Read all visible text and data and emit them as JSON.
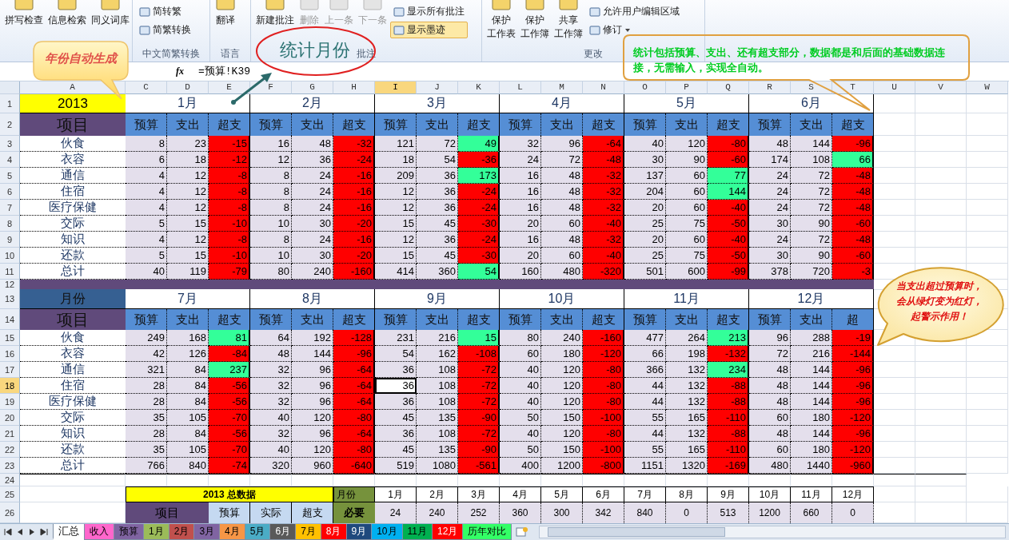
{
  "ribbon": {
    "groups": [
      {
        "large": [
          {
            "lines": [
              "拼写检查"
            ],
            "disabled": false
          },
          {
            "lines": [
              "信息检索"
            ],
            "disabled": false
          },
          {
            "lines": [
              "同义词库"
            ],
            "disabled": false
          }
        ]
      },
      {
        "label": "中文简繁转换",
        "small": [
          {
            "label": "简转繁",
            "selected": false,
            "dropdown": false
          },
          {
            "label": "简繁转换",
            "selected": false,
            "dropdown": false
          }
        ]
      },
      {
        "label": "语言",
        "large": [
          {
            "lines": [
              "翻译"
            ],
            "disabled": false
          }
        ]
      },
      {
        "label": "批注",
        "large": [
          {
            "lines": [
              "新建批注"
            ],
            "disabled": false
          },
          {
            "lines": [
              "删除"
            ],
            "disabled": true
          },
          {
            "lines": [
              "上一条"
            ],
            "disabled": true
          },
          {
            "lines": [
              "下一条"
            ],
            "disabled": true
          }
        ],
        "small": [
          {
            "label": "显示所有批注",
            "selected": false,
            "dropdown": false
          },
          {
            "label": "显示墨迹",
            "selected": true,
            "dropdown": false
          }
        ]
      },
      {
        "label": "更改",
        "large": [
          {
            "lines": [
              "保护",
              "工作表"
            ],
            "disabled": false
          },
          {
            "lines": [
              "保护",
              "工作簿"
            ],
            "disabled": false
          },
          {
            "lines": [
              "共享",
              "工作簿"
            ],
            "disabled": false
          }
        ],
        "small": [
          {
            "label": "允许用户编辑区域",
            "selected": false,
            "dropdown": false
          },
          {
            "label": "修订",
            "selected": false,
            "dropdown": true
          }
        ]
      }
    ]
  },
  "formula_bar": {
    "function_label": "fx",
    "formula": "=预算!K39"
  },
  "sheet": {
    "column_headers": [
      {
        "label": "A",
        "selected": false
      },
      {
        "label": "C",
        "selected": false
      },
      {
        "label": "D",
        "selected": false
      },
      {
        "label": "E",
        "selected": false
      },
      {
        "label": "F",
        "selected": false
      },
      {
        "label": "G",
        "selected": false
      },
      {
        "label": "H",
        "selected": false
      },
      {
        "label": "I",
        "selected": true
      },
      {
        "label": "J",
        "selected": false
      },
      {
        "label": "K",
        "selected": false
      },
      {
        "label": "L",
        "selected": false
      },
      {
        "label": "M",
        "selected": false
      },
      {
        "label": "N",
        "selected": false
      },
      {
        "label": "O",
        "selected": false
      },
      {
        "label": "P",
        "selected": false
      },
      {
        "label": "Q",
        "selected": false
      },
      {
        "label": "R",
        "selected": false
      },
      {
        "label": "S",
        "selected": false
      },
      {
        "label": "T",
        "selected": false
      },
      {
        "label": "U",
        "selected": false
      },
      {
        "label": "V",
        "selected": false
      },
      {
        "label": "W",
        "selected": false
      }
    ],
    "row_headers": [
      {
        "label": "1",
        "selected": false
      },
      {
        "label": "2",
        "selected": false
      },
      {
        "label": "3",
        "selected": false
      },
      {
        "label": "4",
        "selected": false
      },
      {
        "label": "5",
        "selected": false
      },
      {
        "label": "6",
        "selected": false
      },
      {
        "label": "7",
        "selected": false
      },
      {
        "label": "8",
        "selected": false
      },
      {
        "label": "9",
        "selected": false
      },
      {
        "label": "10",
        "selected": false
      },
      {
        "label": "11",
        "selected": false
      },
      {
        "label": "12",
        "selected": false
      },
      {
        "label": "13",
        "selected": false
      },
      {
        "label": "14",
        "selected": false
      },
      {
        "label": "15",
        "selected": false
      },
      {
        "label": "16",
        "selected": false
      },
      {
        "label": "17",
        "selected": false
      },
      {
        "label": "18",
        "selected": true
      },
      {
        "label": "19",
        "selected": false
      },
      {
        "label": "20",
        "selected": false
      },
      {
        "label": "21",
        "selected": false
      },
      {
        "label": "22",
        "selected": false
      },
      {
        "label": "23",
        "selected": false
      },
      {
        "label": "24",
        "selected": false
      },
      {
        "label": "25",
        "selected": false
      },
      {
        "label": "26",
        "selected": false
      }
    ],
    "blocks": [
      {
        "corner": "2013",
        "kind": "year",
        "item_header": "项目",
        "months": [
          {
            "label": "1月",
            "columns": [
              "预算",
              "支出",
              "超支"
            ]
          },
          {
            "label": "2月",
            "columns": [
              "预算",
              "支出",
              "超支"
            ]
          },
          {
            "label": "3月",
            "columns": [
              "预算",
              "支出",
              "超支"
            ]
          },
          {
            "label": "4月",
            "columns": [
              "预算",
              "支出",
              "超支"
            ]
          },
          {
            "label": "5月",
            "columns": [
              "预算",
              "支出",
              "超支"
            ]
          },
          {
            "label": "6月",
            "columns": [
              "预算",
              "支出",
              "超支"
            ]
          }
        ],
        "rows": [
          {
            "item": "伙食",
            "months": [
              {
                "values": [
                  "8",
                  "23",
                  "-15"
                ],
                "alert": true
              },
              {
                "values": [
                  "16",
                  "48",
                  "-32"
                ],
                "alert": true
              },
              {
                "values": [
                  "121",
                  "72",
                  "49"
                ],
                "alert": false
              },
              {
                "values": [
                  "32",
                  "96",
                  "-64"
                ],
                "alert": true
              },
              {
                "values": [
                  "40",
                  "120",
                  "-80"
                ],
                "alert": true
              },
              {
                "values": [
                  "48",
                  "144",
                  "-96"
                ],
                "alert": true
              }
            ]
          },
          {
            "item": "衣容",
            "months": [
              {
                "values": [
                  "6",
                  "18",
                  "-12"
                ],
                "alert": true
              },
              {
                "values": [
                  "12",
                  "36",
                  "-24"
                ],
                "alert": true
              },
              {
                "values": [
                  "18",
                  "54",
                  "-36"
                ],
                "alert": true
              },
              {
                "values": [
                  "24",
                  "72",
                  "-48"
                ],
                "alert": true
              },
              {
                "values": [
                  "30",
                  "90",
                  "-60"
                ],
                "alert": true
              },
              {
                "values": [
                  "174",
                  "108",
                  "66"
                ],
                "alert": false
              }
            ]
          },
          {
            "item": "通信",
            "months": [
              {
                "values": [
                  "4",
                  "12",
                  "-8"
                ],
                "alert": true
              },
              {
                "values": [
                  "8",
                  "24",
                  "-16"
                ],
                "alert": true
              },
              {
                "values": [
                  "209",
                  "36",
                  "173"
                ],
                "alert": false
              },
              {
                "values": [
                  "16",
                  "48",
                  "-32"
                ],
                "alert": true
              },
              {
                "values": [
                  "137",
                  "60",
                  "77"
                ],
                "alert": false
              },
              {
                "values": [
                  "24",
                  "72",
                  "-48"
                ],
                "alert": true
              }
            ]
          },
          {
            "item": "住宿",
            "months": [
              {
                "values": [
                  "4",
                  "12",
                  "-8"
                ],
                "alert": true
              },
              {
                "values": [
                  "8",
                  "24",
                  "-16"
                ],
                "alert": true
              },
              {
                "values": [
                  "12",
                  "36",
                  "-24"
                ],
                "alert": true
              },
              {
                "values": [
                  "16",
                  "48",
                  "-32"
                ],
                "alert": true
              },
              {
                "values": [
                  "204",
                  "60",
                  "144"
                ],
                "alert": false
              },
              {
                "values": [
                  "24",
                  "72",
                  "-48"
                ],
                "alert": true
              }
            ]
          },
          {
            "item": "医疗保健",
            "months": [
              {
                "values": [
                  "4",
                  "12",
                  "-8"
                ],
                "alert": true
              },
              {
                "values": [
                  "8",
                  "24",
                  "-16"
                ],
                "alert": true
              },
              {
                "values": [
                  "12",
                  "36",
                  "-24"
                ],
                "alert": true
              },
              {
                "values": [
                  "16",
                  "48",
                  "-32"
                ],
                "alert": true
              },
              {
                "values": [
                  "20",
                  "60",
                  "-40"
                ],
                "alert": true
              },
              {
                "values": [
                  "24",
                  "72",
                  "-48"
                ],
                "alert": true
              }
            ]
          },
          {
            "item": "交际",
            "months": [
              {
                "values": [
                  "5",
                  "15",
                  "-10"
                ],
                "alert": true
              },
              {
                "values": [
                  "10",
                  "30",
                  "-20"
                ],
                "alert": true
              },
              {
                "values": [
                  "15",
                  "45",
                  "-30"
                ],
                "alert": true
              },
              {
                "values": [
                  "20",
                  "60",
                  "-40"
                ],
                "alert": true
              },
              {
                "values": [
                  "25",
                  "75",
                  "-50"
                ],
                "alert": true
              },
              {
                "values": [
                  "30",
                  "90",
                  "-60"
                ],
                "alert": true
              }
            ]
          },
          {
            "item": "知识",
            "months": [
              {
                "values": [
                  "4",
                  "12",
                  "-8"
                ],
                "alert": true
              },
              {
                "values": [
                  "8",
                  "24",
                  "-16"
                ],
                "alert": true
              },
              {
                "values": [
                  "12",
                  "36",
                  "-24"
                ],
                "alert": true
              },
              {
                "values": [
                  "16",
                  "48",
                  "-32"
                ],
                "alert": true
              },
              {
                "values": [
                  "20",
                  "60",
                  "-40"
                ],
                "alert": true
              },
              {
                "values": [
                  "24",
                  "72",
                  "-48"
                ],
                "alert": true
              }
            ]
          },
          {
            "item": "还款",
            "months": [
              {
                "values": [
                  "5",
                  "15",
                  "-10"
                ],
                "alert": true
              },
              {
                "values": [
                  "10",
                  "30",
                  "-20"
                ],
                "alert": true
              },
              {
                "values": [
                  "15",
                  "45",
                  "-30"
                ],
                "alert": true
              },
              {
                "values": [
                  "20",
                  "60",
                  "-40"
                ],
                "alert": true
              },
              {
                "values": [
                  "25",
                  "75",
                  "-50"
                ],
                "alert": true
              },
              {
                "values": [
                  "30",
                  "90",
                  "-60"
                ],
                "alert": true
              }
            ]
          },
          {
            "item": "总计",
            "months": [
              {
                "values": [
                  "40",
                  "119",
                  "-79"
                ],
                "alert": true
              },
              {
                "values": [
                  "80",
                  "240",
                  "-160"
                ],
                "alert": true
              },
              {
                "values": [
                  "414",
                  "360",
                  "54"
                ],
                "alert": false
              },
              {
                "values": [
                  "160",
                  "480",
                  "-320"
                ],
                "alert": true
              },
              {
                "values": [
                  "501",
                  "600",
                  "-99"
                ],
                "alert": true
              },
              {
                "values": [
                  "378",
                  "720",
                  "-3"
                ],
                "alert": true
              }
            ]
          }
        ]
      },
      {
        "corner": "月份",
        "kind": "label",
        "item_header": "项目",
        "months": [
          {
            "label": "7月",
            "columns": [
              "预算",
              "支出",
              "超支"
            ]
          },
          {
            "label": "8月",
            "columns": [
              "预算",
              "支出",
              "超支"
            ]
          },
          {
            "label": "9月",
            "columns": [
              "预算",
              "支出",
              "超支"
            ]
          },
          {
            "label": "10月",
            "columns": [
              "预算",
              "支出",
              "超支"
            ]
          },
          {
            "label": "11月",
            "columns": [
              "预算",
              "支出",
              "超支"
            ]
          },
          {
            "label": "12月",
            "columns": [
              "预算",
              "支出",
              "超"
            ]
          }
        ],
        "rows": [
          {
            "item": "伙食",
            "months": [
              {
                "values": [
                  "249",
                  "168",
                  "81"
                ],
                "alert": false
              },
              {
                "values": [
                  "64",
                  "192",
                  "-128"
                ],
                "alert": true
              },
              {
                "values": [
                  "231",
                  "216",
                  "15"
                ],
                "alert": false
              },
              {
                "values": [
                  "80",
                  "240",
                  "-160"
                ],
                "alert": true
              },
              {
                "values": [
                  "477",
                  "264",
                  "213"
                ],
                "alert": false
              },
              {
                "values": [
                  "96",
                  "288",
                  "-19"
                ],
                "alert": true
              }
            ]
          },
          {
            "item": "衣容",
            "months": [
              {
                "values": [
                  "42",
                  "126",
                  "-84"
                ],
                "alert": true
              },
              {
                "values": [
                  "48",
                  "144",
                  "-96"
                ],
                "alert": true
              },
              {
                "values": [
                  "54",
                  "162",
                  "-108"
                ],
                "alert": true
              },
              {
                "values": [
                  "60",
                  "180",
                  "-120"
                ],
                "alert": true
              },
              {
                "values": [
                  "66",
                  "198",
                  "-132"
                ],
                "alert": true
              },
              {
                "values": [
                  "72",
                  "216",
                  "-144"
                ],
                "alert": true
              }
            ]
          },
          {
            "item": "通信",
            "months": [
              {
                "values": [
                  "321",
                  "84",
                  "237"
                ],
                "alert": false
              },
              {
                "values": [
                  "32",
                  "96",
                  "-64"
                ],
                "alert": true
              },
              {
                "values": [
                  "36",
                  "108",
                  "-72"
                ],
                "alert": true
              },
              {
                "values": [
                  "40",
                  "120",
                  "-80"
                ],
                "alert": true
              },
              {
                "values": [
                  "366",
                  "132",
                  "234"
                ],
                "alert": false
              },
              {
                "values": [
                  "48",
                  "144",
                  "-96"
                ],
                "alert": true
              }
            ]
          },
          {
            "item": "住宿",
            "months": [
              {
                "values": [
                  "28",
                  "84",
                  "-56"
                ],
                "alert": true
              },
              {
                "values": [
                  "32",
                  "96",
                  "-64"
                ],
                "alert": true
              },
              {
                "values": [
                  "36",
                  "108",
                  "-72"
                ],
                "alert": true
              },
              {
                "values": [
                  "40",
                  "120",
                  "-80"
                ],
                "alert": true
              },
              {
                "values": [
                  "44",
                  "132",
                  "-88"
                ],
                "alert": true
              },
              {
                "values": [
                  "48",
                  "144",
                  "-96"
                ],
                "alert": true
              }
            ]
          },
          {
            "item": "医疗保健",
            "months": [
              {
                "values": [
                  "28",
                  "84",
                  "-56"
                ],
                "alert": true
              },
              {
                "values": [
                  "32",
                  "96",
                  "-64"
                ],
                "alert": true
              },
              {
                "values": [
                  "36",
                  "108",
                  "-72"
                ],
                "alert": true
              },
              {
                "values": [
                  "40",
                  "120",
                  "-80"
                ],
                "alert": true
              },
              {
                "values": [
                  "44",
                  "132",
                  "-88"
                ],
                "alert": true
              },
              {
                "values": [
                  "48",
                  "144",
                  "-96"
                ],
                "alert": true
              }
            ]
          },
          {
            "item": "交际",
            "months": [
              {
                "values": [
                  "35",
                  "105",
                  "-70"
                ],
                "alert": true
              },
              {
                "values": [
                  "40",
                  "120",
                  "-80"
                ],
                "alert": true
              },
              {
                "values": [
                  "45",
                  "135",
                  "-90"
                ],
                "alert": true
              },
              {
                "values": [
                  "50",
                  "150",
                  "-100"
                ],
                "alert": true
              },
              {
                "values": [
                  "55",
                  "165",
                  "-110"
                ],
                "alert": true
              },
              {
                "values": [
                  "60",
                  "180",
                  "-120"
                ],
                "alert": true
              }
            ]
          },
          {
            "item": "知识",
            "months": [
              {
                "values": [
                  "28",
                  "84",
                  "-56"
                ],
                "alert": true
              },
              {
                "values": [
                  "32",
                  "96",
                  "-64"
                ],
                "alert": true
              },
              {
                "values": [
                  "36",
                  "108",
                  "-72"
                ],
                "alert": true
              },
              {
                "values": [
                  "40",
                  "120",
                  "-80"
                ],
                "alert": true
              },
              {
                "values": [
                  "44",
                  "132",
                  "-88"
                ],
                "alert": true
              },
              {
                "values": [
                  "48",
                  "144",
                  "-96"
                ],
                "alert": true
              }
            ]
          },
          {
            "item": "还款",
            "months": [
              {
                "values": [
                  "35",
                  "105",
                  "-70"
                ],
                "alert": true
              },
              {
                "values": [
                  "40",
                  "120",
                  "-80"
                ],
                "alert": true
              },
              {
                "values": [
                  "45",
                  "135",
                  "-90"
                ],
                "alert": true
              },
              {
                "values": [
                  "50",
                  "150",
                  "-100"
                ],
                "alert": true
              },
              {
                "values": [
                  "55",
                  "165",
                  "-110"
                ],
                "alert": true
              },
              {
                "values": [
                  "60",
                  "180",
                  "-120"
                ],
                "alert": true
              }
            ]
          },
          {
            "item": "总计",
            "months": [
              {
                "values": [
                  "766",
                  "840",
                  "-74"
                ],
                "alert": true
              },
              {
                "values": [
                  "320",
                  "960",
                  "-640"
                ],
                "alert": true
              },
              {
                "values": [
                  "519",
                  "1080",
                  "-561"
                ],
                "alert": true
              },
              {
                "values": [
                  "400",
                  "1200",
                  "-800"
                ],
                "alert": true
              },
              {
                "values": [
                  "1151",
                  "1320",
                  "-169"
                ],
                "alert": true
              },
              {
                "values": [
                  "480",
                  "1440",
                  "-960"
                ],
                "alert": true
              }
            ]
          }
        ]
      }
    ],
    "summary": {
      "title": "2013 总数据",
      "month_label": "月份",
      "months": [
        "1月",
        "2月",
        "3月",
        "4月",
        "5月",
        "6月",
        "7月",
        "8月",
        "9月",
        "10月",
        "11月",
        "12月"
      ],
      "item_header": "项目",
      "columns": [
        "预算",
        "实际",
        "超支"
      ],
      "row_label": "必要",
      "values": [
        "24",
        "240",
        "252",
        "360",
        "300",
        "342",
        "840",
        "0",
        "513",
        "1200",
        "660",
        "0"
      ]
    }
  },
  "tabs": [
    {
      "label": "汇总",
      "selected": true
    },
    {
      "label": "收入",
      "selected": false,
      "color": "#ff66cc"
    },
    {
      "label": "预算",
      "selected": false,
      "color": "#8064a2"
    },
    {
      "label": "1月",
      "selected": false,
      "color": "#9bbb59"
    },
    {
      "label": "2月",
      "selected": false,
      "color": "#c0504d"
    },
    {
      "label": "3月",
      "selected": false,
      "color": "#8064a2"
    },
    {
      "label": "4月",
      "selected": false,
      "color": "#f79646"
    },
    {
      "label": "5月",
      "selected": false,
      "color": "#4bacc6"
    },
    {
      "label": "6月",
      "selected": false,
      "color": "#595959"
    },
    {
      "label": "7月",
      "selected": false,
      "color": "#ffc000"
    },
    {
      "label": "8月",
      "selected": false,
      "color": "#ff0000"
    },
    {
      "label": "9月",
      "selected": false,
      "color": "#1f497d"
    },
    {
      "label": "10月",
      "selected": false,
      "color": "#00b0f0"
    },
    {
      "label": "11月",
      "selected": false,
      "color": "#00b050"
    },
    {
      "label": "12月",
      "selected": false,
      "color": "#ff0000"
    },
    {
      "label": "历年对比",
      "selected": false,
      "color": "#33ff66"
    }
  ],
  "callouts": {
    "year_note": "年份自动生成",
    "month_title": "统计月份",
    "info": "统计包括预算、支出、还有超支部分，数据都是和后面的基础数据连接，无需输入，实现全自动。",
    "warning": "当支出超过预算时，会从绿灯变为红灯，起警示作用！"
  }
}
